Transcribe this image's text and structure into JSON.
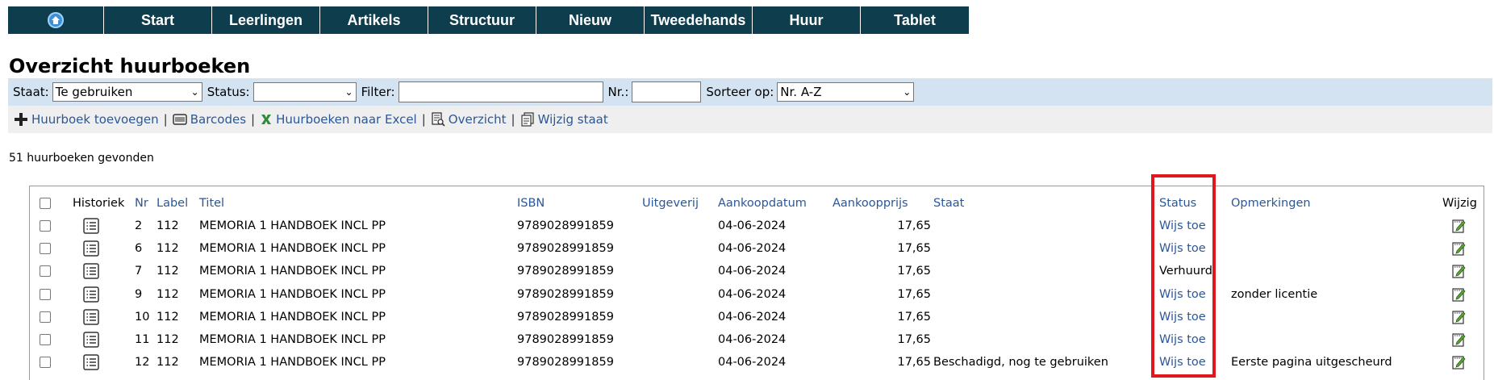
{
  "nav": {
    "items": [
      "Start",
      "Leerlingen",
      "Artikels",
      "Structuur",
      "Nieuw",
      "Tweedehands",
      "Huur",
      "Tablet"
    ]
  },
  "title": "Overzicht huurboeken",
  "filters": {
    "staat_label": "Staat:",
    "staat_value": "Te gebruiken",
    "status_label": "Status:",
    "status_value": "",
    "filter_label": "Filter:",
    "filter_value": "",
    "nr_label": "Nr.:",
    "nr_value": "",
    "sort_label": "Sorteer op:",
    "sort_value": "Nr. A-Z"
  },
  "actions": {
    "add": "Huurboek toevoegen",
    "barcodes": "Barcodes",
    "excel": "Huurboeken naar Excel",
    "overview": "Overzicht",
    "change_state": "Wijzig staat",
    "separator": "|"
  },
  "count_text": "51 huurboeken gevonden",
  "table": {
    "headers": {
      "historiek": "Historiek",
      "nr": "Nr",
      "label": "Label",
      "titel": "Titel",
      "isbn": "ISBN",
      "uitgeverij": "Uitgeverij",
      "aankoopdatum": "Aankoopdatum",
      "aankoopprijs": "Aankoopprijs",
      "staat": "Staat",
      "status": "Status",
      "opmerkingen": "Opmerkingen",
      "wijzig": "Wijzig"
    },
    "rows": [
      {
        "nr": "2",
        "label": "112",
        "titel": "MEMORIA 1 HANDBOEK INCL PP",
        "isbn": "9789028991859",
        "uitgeverij": "",
        "aankoopdatum": "04-06-2024",
        "aankoopprijs": "17,65",
        "staat": "",
        "status": "Wijs toe",
        "opmerkingen": ""
      },
      {
        "nr": "6",
        "label": "112",
        "titel": "MEMORIA 1 HANDBOEK INCL PP",
        "isbn": "9789028991859",
        "uitgeverij": "",
        "aankoopdatum": "04-06-2024",
        "aankoopprijs": "17,65",
        "staat": "",
        "status": "Wijs toe",
        "opmerkingen": ""
      },
      {
        "nr": "7",
        "label": "112",
        "titel": "MEMORIA 1 HANDBOEK INCL PP",
        "isbn": "9789028991859",
        "uitgeverij": "",
        "aankoopdatum": "04-06-2024",
        "aankoopprijs": "17,65",
        "staat": "",
        "status": "Verhuurd",
        "opmerkingen": ""
      },
      {
        "nr": "9",
        "label": "112",
        "titel": "MEMORIA 1 HANDBOEK INCL PP",
        "isbn": "9789028991859",
        "uitgeverij": "",
        "aankoopdatum": "04-06-2024",
        "aankoopprijs": "17,65",
        "staat": "",
        "status": "Wijs toe",
        "opmerkingen": "zonder licentie"
      },
      {
        "nr": "10",
        "label": "112",
        "titel": "MEMORIA 1 HANDBOEK INCL PP",
        "isbn": "9789028991859",
        "uitgeverij": "",
        "aankoopdatum": "04-06-2024",
        "aankoopprijs": "17,65",
        "staat": "",
        "status": "Wijs toe",
        "opmerkingen": ""
      },
      {
        "nr": "11",
        "label": "112",
        "titel": "MEMORIA 1 HANDBOEK INCL PP",
        "isbn": "9789028991859",
        "uitgeverij": "",
        "aankoopdatum": "04-06-2024",
        "aankoopprijs": "17,65",
        "staat": "",
        "status": "Wijs toe",
        "opmerkingen": ""
      },
      {
        "nr": "12",
        "label": "112",
        "titel": "MEMORIA 1 HANDBOEK INCL PP",
        "isbn": "9789028991859",
        "uitgeverij": "",
        "aankoopdatum": "04-06-2024",
        "aankoopprijs": "17,65",
        "staat": "Beschadigd, nog te gebruiken",
        "status": "Wijs toe",
        "opmerkingen": "Eerste pagina uitgescheurd"
      }
    ]
  },
  "colors": {
    "nav_bg": "#0e3d4e",
    "filter_bg": "#d3e3f1",
    "action_bg": "#efefef",
    "link": "#2b5797",
    "highlight": "#e0181e"
  }
}
